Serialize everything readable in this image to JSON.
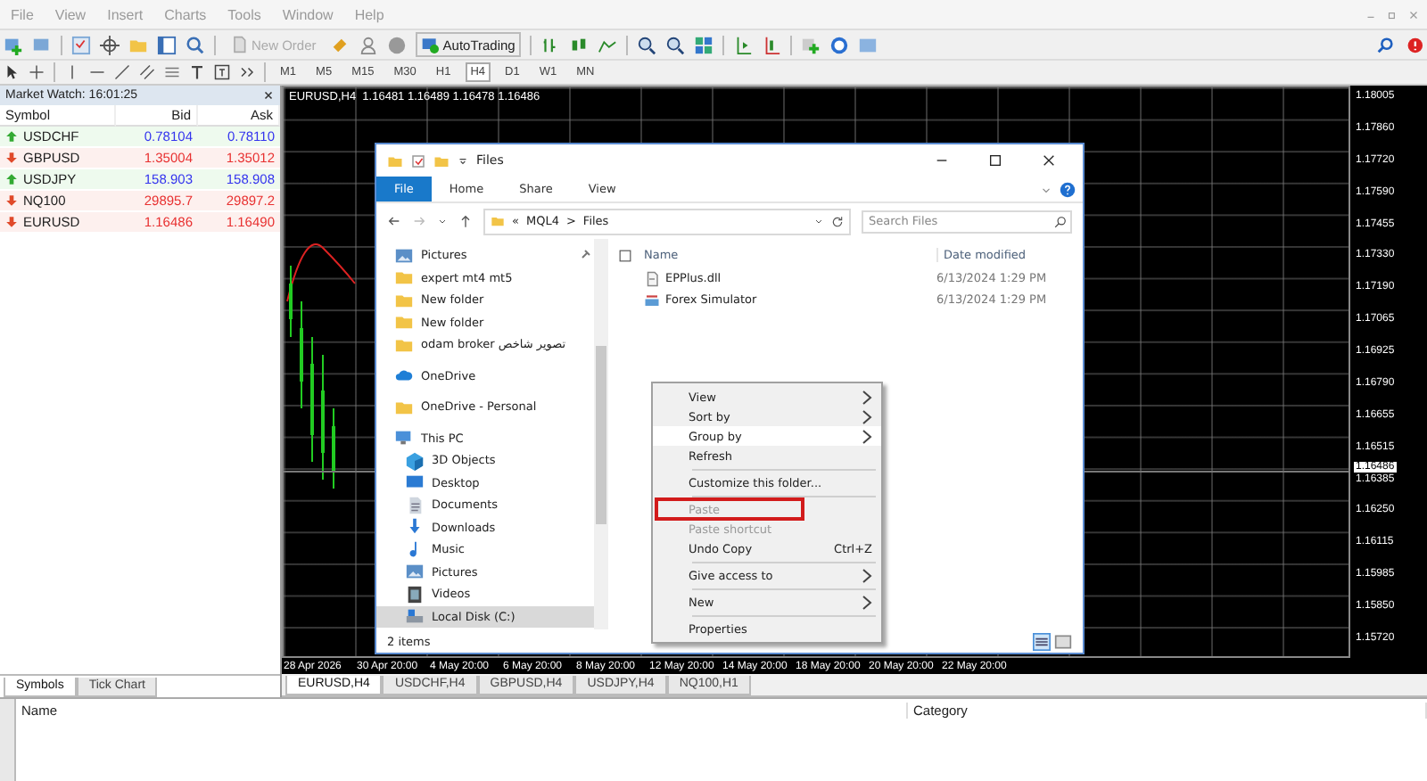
{
  "menu": [
    "File",
    "View",
    "Insert",
    "Charts",
    "Tools",
    "Window",
    "Help"
  ],
  "toolbar": {
    "new_order": {
      "label": "New Order",
      "disabled": true
    },
    "autotrading": {
      "label": "AutoTrading"
    }
  },
  "timeframes": [
    {
      "label": "M1",
      "selected": false
    },
    {
      "label": "M5",
      "selected": false
    },
    {
      "label": "M15",
      "selected": false
    },
    {
      "label": "M30",
      "selected": false
    },
    {
      "label": "H1",
      "selected": false
    },
    {
      "label": "H4",
      "selected": true
    },
    {
      "label": "D1",
      "selected": false
    },
    {
      "label": "W1",
      "selected": false
    },
    {
      "label": "MN",
      "selected": false
    }
  ],
  "market_watch": {
    "title": "Market Watch: 16:01:25",
    "columns": [
      "Symbol",
      "Bid",
      "Ask"
    ],
    "rows": [
      {
        "symbol": "USDCHF",
        "bid": "0.78104",
        "ask": "0.78110",
        "kind": "up"
      },
      {
        "symbol": "GBPUSD",
        "bid": "1.35004",
        "ask": "1.35012",
        "kind": "down"
      },
      {
        "symbol": "USDJPY",
        "bid": "158.903",
        "ask": "158.908",
        "kind": "up"
      },
      {
        "symbol": "NQ100",
        "bid": "29895.7",
        "ask": "29897.2",
        "kind": "down"
      },
      {
        "symbol": "EURUSD",
        "bid": "1.16486",
        "ask": "1.16490",
        "kind": "down"
      }
    ],
    "tabs": [
      {
        "label": "Symbols",
        "selected": true
      },
      {
        "label": "Tick Chart",
        "selected": false
      }
    ]
  },
  "chart": {
    "header": "EURUSD,H4  1.16481 1.16489 1.16478 1.16486",
    "price_labels": [
      "1.18005",
      "1.17860",
      "1.17720",
      "1.17590",
      "1.17455",
      "1.17330",
      "1.17190",
      "1.17065",
      "1.16925",
      "1.16790",
      "1.16655",
      "1.16515",
      "1.16385",
      "1.16250",
      "1.16115",
      "1.15985",
      "1.15850",
      "1.15720"
    ],
    "current_price": "1.16486",
    "time_labels": [
      "28 Apr 2026",
      "30 Apr 20:00",
      "4 May 20:00",
      "6 May 20:00",
      "8 May 20:00",
      "12 May 20:00",
      "14 May 20:00",
      "18 May 20:00",
      "20 May 20:00",
      "22 May 20:00"
    ]
  },
  "chart_tabs": [
    {
      "label": "EURUSD,H4",
      "selected": true
    },
    {
      "label": "USDCHF,H4",
      "selected": false
    },
    {
      "label": "GBPUSD,H4",
      "selected": false
    },
    {
      "label": "USDJPY,H4",
      "selected": false
    },
    {
      "label": "NQ100,H1",
      "selected": false
    }
  ],
  "explorer": {
    "title": "Files",
    "ribbon_tabs": [
      {
        "label": "File",
        "selected": true
      },
      {
        "label": "Home",
        "selected": false
      },
      {
        "label": "Share",
        "selected": false
      },
      {
        "label": "View",
        "selected": false
      }
    ],
    "path": [
      "«",
      "MQL4",
      ">",
      "Files"
    ],
    "search": {
      "placeholder": "Search Files"
    },
    "nav_sections": [
      [
        {
          "label": "Pictures",
          "kind": "pictures",
          "pinned": true,
          "selected": false
        },
        {
          "label": "expert mt4 mt5",
          "kind": "folder",
          "selected": false
        },
        {
          "label": "New folder",
          "kind": "folder",
          "selected": false
        },
        {
          "label": "New folder",
          "kind": "folder",
          "selected": false
        },
        {
          "label": "odam broker تصویر شاخص",
          "kind": "folder",
          "selected": false
        }
      ],
      [
        {
          "label": "OneDrive",
          "kind": "cloud",
          "selected": false
        }
      ],
      [
        {
          "label": "OneDrive - Personal",
          "kind": "folder",
          "selected": false
        }
      ],
      [
        {
          "label": "This PC",
          "kind": "pc",
          "selected": false,
          "children": [
            {
              "label": "3D Objects",
              "kind": "cube",
              "selected": false
            },
            {
              "label": "Desktop",
              "kind": "desktop",
              "selected": false
            },
            {
              "label": "Documents",
              "kind": "documents",
              "selected": false
            },
            {
              "label": "Downloads",
              "kind": "downloads",
              "selected": false
            },
            {
              "label": "Music",
              "kind": "music",
              "selected": false
            },
            {
              "label": "Pictures",
              "kind": "pictures",
              "selected": false
            },
            {
              "label": "Videos",
              "kind": "videos",
              "selected": false
            },
            {
              "label": "Local Disk (C:)",
              "kind": "disk",
              "selected": true
            }
          ]
        }
      ]
    ],
    "select_all": {
      "checked": false
    },
    "columns": [
      "Name",
      "Date modified"
    ],
    "files": [
      {
        "name": "EPPlus.dll",
        "modified": "6/13/2024 1:29 PM",
        "kind": "dll"
      },
      {
        "name": "Forex Simulator",
        "modified": "6/13/2024 1:29 PM",
        "kind": "app"
      }
    ],
    "status": "2 items"
  },
  "context_menu": [
    {
      "kind": "item",
      "label": "View",
      "submenu": true,
      "disabled": false,
      "selected": false
    },
    {
      "kind": "item",
      "label": "Sort by",
      "submenu": true,
      "disabled": false,
      "selected": false
    },
    {
      "kind": "item",
      "label": "Group by",
      "submenu": true,
      "disabled": false,
      "selected": true
    },
    {
      "kind": "item",
      "label": "Refresh",
      "submenu": false,
      "disabled": false,
      "selected": false
    },
    {
      "kind": "separator"
    },
    {
      "kind": "item",
      "label": "Customize this folder...",
      "submenu": false,
      "disabled": false,
      "selected": false
    },
    {
      "kind": "separator"
    },
    {
      "kind": "item",
      "label": "Paste",
      "submenu": false,
      "disabled": true,
      "selected": false,
      "outlined": true
    },
    {
      "kind": "item",
      "label": "Paste shortcut",
      "submenu": false,
      "disabled": true,
      "selected": false
    },
    {
      "kind": "item",
      "label": "Undo Copy",
      "shortcut": "Ctrl+Z",
      "submenu": false,
      "disabled": false,
      "selected": false
    },
    {
      "kind": "separator"
    },
    {
      "kind": "item",
      "label": "Give access to",
      "submenu": true,
      "disabled": false,
      "selected": false
    },
    {
      "kind": "separator"
    },
    {
      "kind": "item",
      "label": "New",
      "submenu": true,
      "disabled": false,
      "selected": false
    },
    {
      "kind": "separator"
    },
    {
      "kind": "item",
      "label": "Properties",
      "submenu": false,
      "disabled": false,
      "selected": false
    }
  ],
  "bottom_panel": {
    "columns": [
      "Name",
      "Category"
    ]
  }
}
